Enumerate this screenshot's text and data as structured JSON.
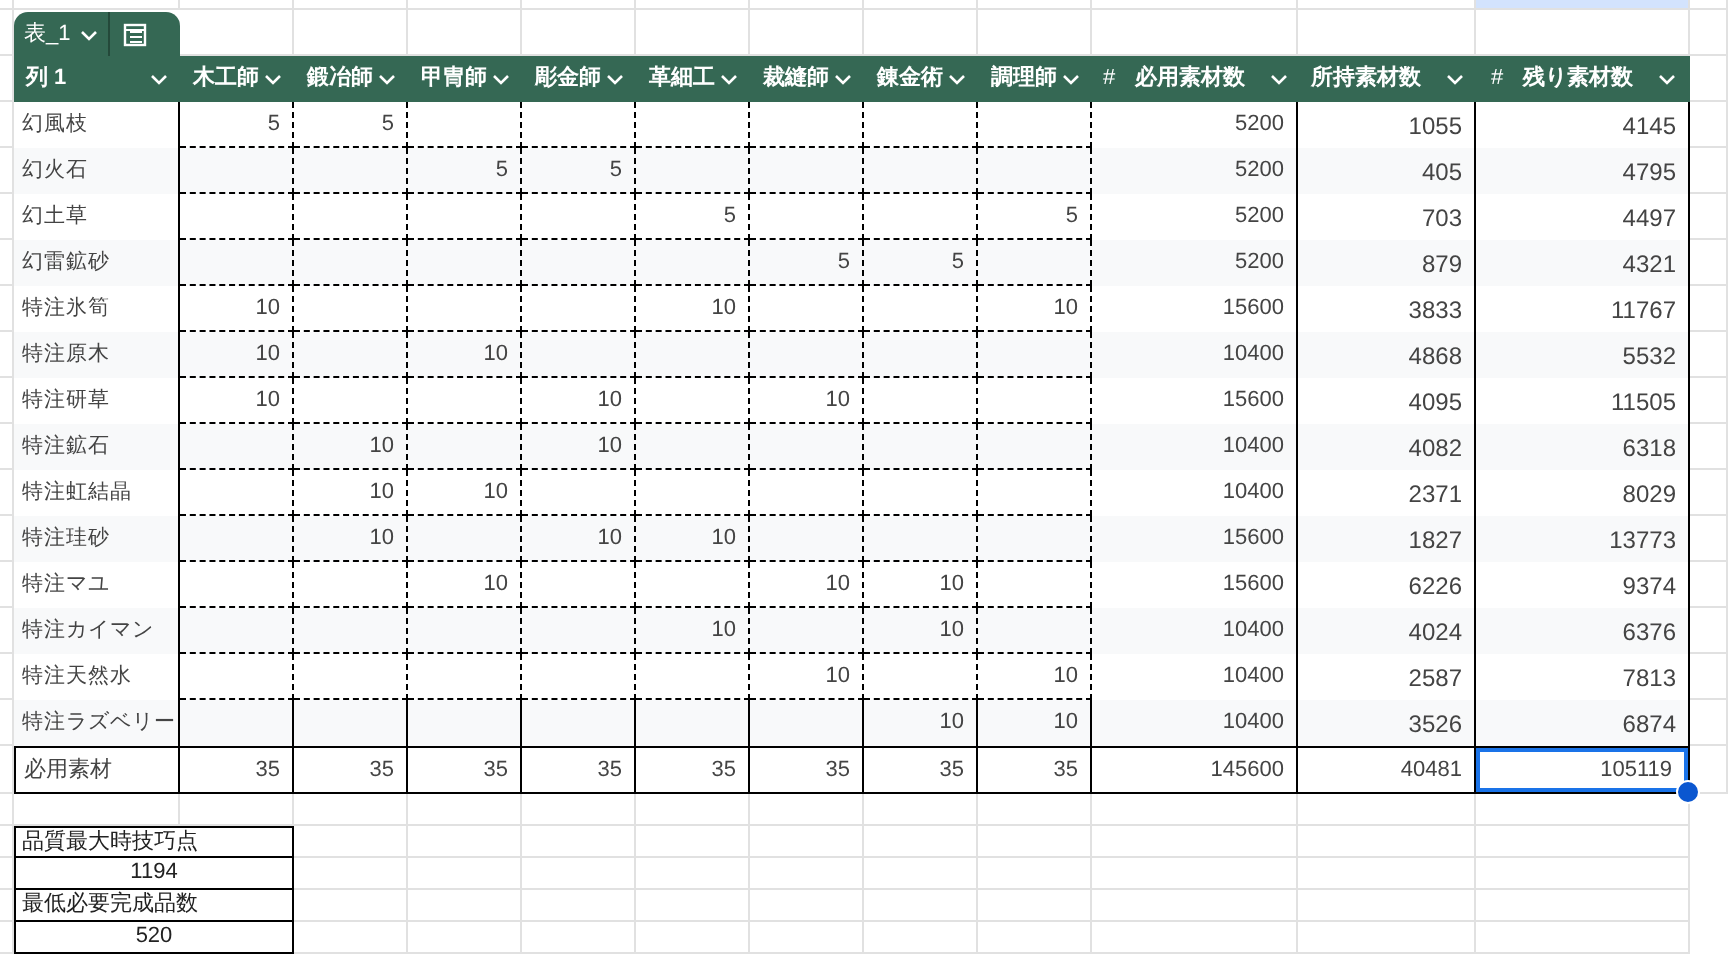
{
  "sheet_tab": {
    "label": "表_1"
  },
  "columns": [
    {
      "label": "列 1",
      "kind": "text"
    },
    {
      "label": "木工師",
      "kind": "craft"
    },
    {
      "label": "鍛冶師",
      "kind": "craft"
    },
    {
      "label": "甲冑師",
      "kind": "craft"
    },
    {
      "label": "彫金師",
      "kind": "craft"
    },
    {
      "label": "革細工",
      "kind": "craft"
    },
    {
      "label": "裁縫師",
      "kind": "craft"
    },
    {
      "label": "錬金術",
      "kind": "craft"
    },
    {
      "label": "調理師",
      "kind": "craft"
    },
    {
      "label": "必用素材数",
      "kind": "number",
      "prefix": "#"
    },
    {
      "label": "所持素材数",
      "kind": "number"
    },
    {
      "label": "残り素材数",
      "kind": "number",
      "prefix": "#"
    }
  ],
  "rows": [
    {
      "label": "幻風枝",
      "cells": [
        {
          "kind": "value",
          "text": "5"
        },
        {
          "kind": "value",
          "text": "5"
        },
        {
          "kind": "empty"
        },
        {
          "kind": "empty"
        },
        {
          "kind": "empty"
        },
        {
          "kind": "empty"
        },
        {
          "kind": "empty"
        },
        {
          "kind": "empty"
        }
      ],
      "required": "5200",
      "owned": "1055",
      "remaining": "4145"
    },
    {
      "label": "幻火石",
      "cells": [
        {
          "kind": "empty"
        },
        {
          "kind": "empty"
        },
        {
          "kind": "value",
          "text": "5"
        },
        {
          "kind": "value",
          "text": "5"
        },
        {
          "kind": "empty"
        },
        {
          "kind": "empty"
        },
        {
          "kind": "empty"
        },
        {
          "kind": "empty"
        }
      ],
      "required": "5200",
      "owned": "405",
      "remaining": "4795"
    },
    {
      "label": "幻土草",
      "cells": [
        {
          "kind": "empty"
        },
        {
          "kind": "empty"
        },
        {
          "kind": "empty"
        },
        {
          "kind": "empty"
        },
        {
          "kind": "value",
          "text": "5"
        },
        {
          "kind": "empty"
        },
        {
          "kind": "empty"
        },
        {
          "kind": "value",
          "text": "5"
        }
      ],
      "required": "5200",
      "owned": "703",
      "remaining": "4497"
    },
    {
      "label": "幻雷鉱砂",
      "cells": [
        {
          "kind": "empty"
        },
        {
          "kind": "empty"
        },
        {
          "kind": "empty"
        },
        {
          "kind": "empty"
        },
        {
          "kind": "empty"
        },
        {
          "kind": "value",
          "text": "5"
        },
        {
          "kind": "value",
          "text": "5"
        },
        {
          "kind": "empty"
        }
      ],
      "required": "5200",
      "owned": "879",
      "remaining": "4321"
    },
    {
      "label": "特注氷筍",
      "cells": [
        {
          "kind": "value",
          "text": "10"
        },
        {
          "kind": "empty"
        },
        {
          "kind": "empty"
        },
        {
          "kind": "empty"
        },
        {
          "kind": "value",
          "text": "10"
        },
        {
          "kind": "empty"
        },
        {
          "kind": "empty"
        },
        {
          "kind": "value",
          "text": "10"
        }
      ],
      "required": "15600",
      "owned": "3833",
      "remaining": "11767"
    },
    {
      "label": "特注原木",
      "cells": [
        {
          "kind": "value",
          "text": "10"
        },
        {
          "kind": "empty"
        },
        {
          "kind": "value",
          "text": "10"
        },
        {
          "kind": "empty"
        },
        {
          "kind": "empty"
        },
        {
          "kind": "empty"
        },
        {
          "kind": "empty"
        },
        {
          "kind": "empty"
        }
      ],
      "required": "10400",
      "owned": "4868",
      "remaining": "5532"
    },
    {
      "label": "特注研草",
      "cells": [
        {
          "kind": "value",
          "text": "10"
        },
        {
          "kind": "empty"
        },
        {
          "kind": "empty"
        },
        {
          "kind": "value",
          "text": "10"
        },
        {
          "kind": "empty"
        },
        {
          "kind": "value",
          "text": "10"
        },
        {
          "kind": "empty"
        },
        {
          "kind": "empty"
        }
      ],
      "required": "15600",
      "owned": "4095",
      "remaining": "11505"
    },
    {
      "label": "特注鉱石",
      "cells": [
        {
          "kind": "empty"
        },
        {
          "kind": "value",
          "text": "10"
        },
        {
          "kind": "empty"
        },
        {
          "kind": "value",
          "text": "10"
        },
        {
          "kind": "empty"
        },
        {
          "kind": "empty"
        },
        {
          "kind": "empty"
        },
        {
          "kind": "empty"
        }
      ],
      "required": "10400",
      "owned": "4082",
      "remaining": "6318"
    },
    {
      "label": "特注虹結晶",
      "cells": [
        {
          "kind": "empty"
        },
        {
          "kind": "value",
          "text": "10"
        },
        {
          "kind": "value",
          "text": "10"
        },
        {
          "kind": "empty"
        },
        {
          "kind": "empty"
        },
        {
          "kind": "empty"
        },
        {
          "kind": "empty"
        },
        {
          "kind": "empty"
        }
      ],
      "required": "10400",
      "owned": "2371",
      "remaining": "8029"
    },
    {
      "label": "特注珪砂",
      "cells": [
        {
          "kind": "empty"
        },
        {
          "kind": "value",
          "text": "10"
        },
        {
          "kind": "empty"
        },
        {
          "kind": "value",
          "text": "10"
        },
        {
          "kind": "value",
          "text": "10"
        },
        {
          "kind": "empty"
        },
        {
          "kind": "empty"
        },
        {
          "kind": "empty"
        }
      ],
      "required": "15600",
      "owned": "1827",
      "remaining": "13773"
    },
    {
      "label": "特注マユ",
      "cells": [
        {
          "kind": "empty"
        },
        {
          "kind": "empty"
        },
        {
          "kind": "value",
          "text": "10"
        },
        {
          "kind": "empty"
        },
        {
          "kind": "empty"
        },
        {
          "kind": "value",
          "text": "10"
        },
        {
          "kind": "value",
          "text": "10"
        },
        {
          "kind": "empty"
        }
      ],
      "required": "15600",
      "owned": "6226",
      "remaining": "9374"
    },
    {
      "label": "特注カイマン",
      "cells": [
        {
          "kind": "empty"
        },
        {
          "kind": "empty"
        },
        {
          "kind": "empty"
        },
        {
          "kind": "empty"
        },
        {
          "kind": "value",
          "text": "10"
        },
        {
          "kind": "empty"
        },
        {
          "kind": "value",
          "text": "10"
        },
        {
          "kind": "empty"
        }
      ],
      "required": "10400",
      "owned": "4024",
      "remaining": "6376"
    },
    {
      "label": "特注天然水",
      "cells": [
        {
          "kind": "empty"
        },
        {
          "kind": "empty"
        },
        {
          "kind": "empty"
        },
        {
          "kind": "empty"
        },
        {
          "kind": "empty"
        },
        {
          "kind": "value",
          "text": "10"
        },
        {
          "kind": "empty"
        },
        {
          "kind": "value",
          "text": "10"
        }
      ],
      "required": "10400",
      "owned": "2587",
      "remaining": "7813"
    },
    {
      "label": "特注ラズベリー",
      "cells": [
        {
          "kind": "empty"
        },
        {
          "kind": "empty"
        },
        {
          "kind": "empty"
        },
        {
          "kind": "empty"
        },
        {
          "kind": "empty"
        },
        {
          "kind": "empty"
        },
        {
          "kind": "value",
          "text": "10"
        },
        {
          "kind": "value",
          "text": "10"
        }
      ],
      "required": "10400",
      "owned": "3526",
      "remaining": "6874"
    }
  ],
  "total": {
    "label": "必用素材",
    "values": [
      "35",
      "35",
      "35",
      "35",
      "35",
      "35",
      "35",
      "35"
    ],
    "required": "145600",
    "owned": "40481",
    "remaining": {
      "text": "105119",
      "selected": true
    }
  },
  "summary": [
    {
      "text": "品質最大時技巧点",
      "kind": "label"
    },
    {
      "text": "1194",
      "kind": "value"
    },
    {
      "text": "最低必要完成品数",
      "kind": "label"
    },
    {
      "text": "520",
      "kind": "value"
    }
  ]
}
